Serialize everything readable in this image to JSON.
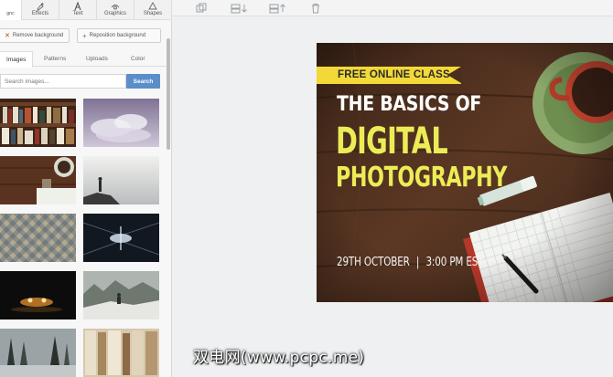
{
  "top_tabs": [
    {
      "label": "gnc",
      "icon": "layout-icon"
    },
    {
      "label": "Effects",
      "icon": "brush-icon"
    },
    {
      "label": "Text",
      "icon": "text-icon"
    },
    {
      "label": "Graphics",
      "icon": "graphics-icon"
    },
    {
      "label": "Shapes",
      "icon": "shapes-icon"
    }
  ],
  "actions": {
    "remove_background": "Remove background",
    "reposition_background": "Reposition background"
  },
  "sub_tabs": [
    "Images",
    "Patterns",
    "Uploads",
    "Color"
  ],
  "active_sub_tab": "Images",
  "search": {
    "placeholder": "Search images...",
    "button": "Search"
  },
  "image_results": [
    "bookshelf",
    "clouds",
    "desk-with-cup",
    "person-on-rock",
    "tiled-wall",
    "tunnel-light",
    "night-lights",
    "person-on-mountain",
    "foggy-trees",
    "old-books"
  ],
  "toolbar_icons": [
    "duplicate-icon",
    "layer-down-icon",
    "layer-up-icon",
    "delete-icon"
  ],
  "poster": {
    "banner": "FREE ONLINE CLASS",
    "title_line1": "THE BASICS OF",
    "title_line2": "DIGITAL",
    "title_line3": "PHOTOGRAPHY",
    "date": "29TH OCTOBER",
    "separator": "|",
    "time": "3:00 PM EST",
    "colors": {
      "accent": "#ecec57",
      "banner": "#f2d938",
      "wood": "#4a2d1d"
    }
  },
  "watermark": "双电网(www.pcpc.me)"
}
